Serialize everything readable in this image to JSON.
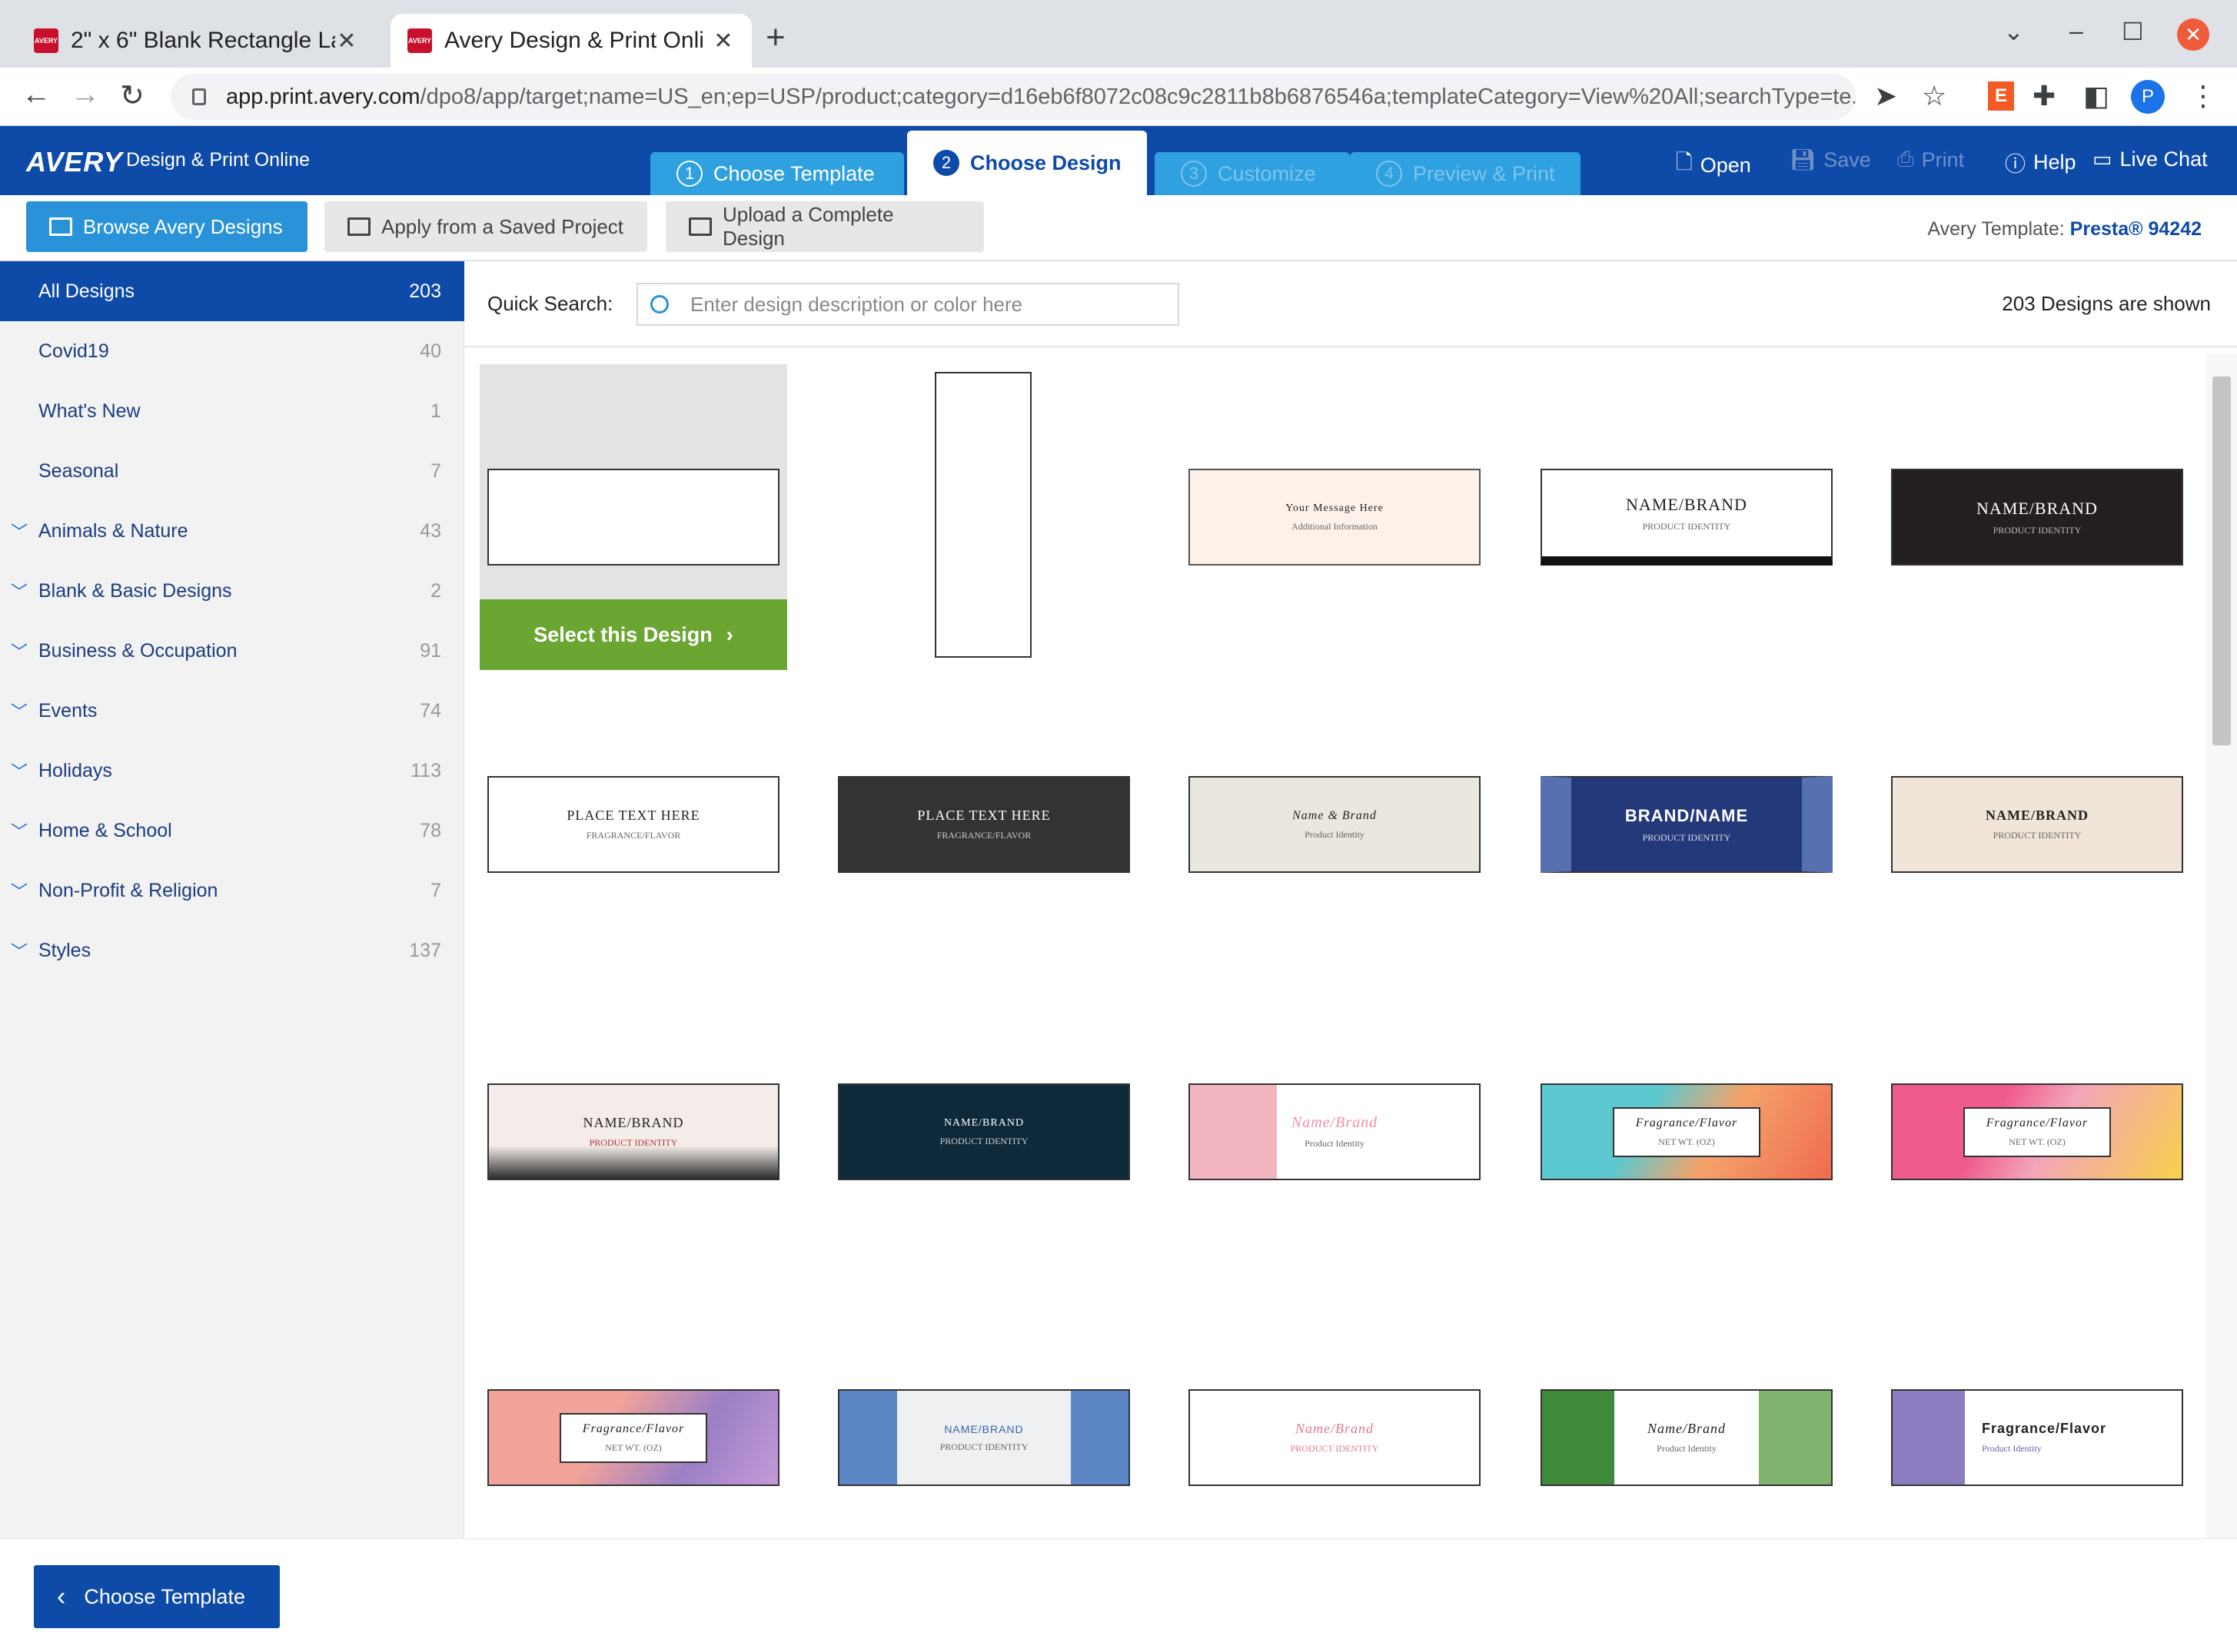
{
  "browser": {
    "tabs": [
      {
        "title": "2\" x 6\" Blank Rectangle La",
        "favicon": "AVERY"
      },
      {
        "title": "Avery Design & Print Onli",
        "favicon": "AVERY"
      }
    ],
    "url_host": "app.print.avery.com",
    "url_path": "/dpo8/app/target;name=US_en;ep=USP/product;category=d16eb6f8072c08c9c2811b8b6876546a;templateCategory=View%20All;searchType=te...",
    "profile_initial": "P",
    "ext_letter": "E"
  },
  "app": {
    "logo": "AVERY",
    "name": "Design & Print Online",
    "steps": [
      {
        "num": "1",
        "label": "Choose Template"
      },
      {
        "num": "2",
        "label": "Choose Design"
      },
      {
        "num": "3",
        "label": "Customize"
      },
      {
        "num": "4",
        "label": "Preview & Print"
      }
    ],
    "actions": {
      "open": "Open",
      "save": "Save",
      "print": "Print",
      "help": "Help",
      "chat": "Live Chat"
    }
  },
  "subbar": {
    "browse": "Browse Avery Designs",
    "apply": "Apply from a Saved Project",
    "upload": "Upload a Complete Design",
    "template_label": "Avery Template:",
    "template_value": "Presta® 94242"
  },
  "sidebar": {
    "items": [
      {
        "label": "All Designs",
        "count": "203"
      },
      {
        "label": "Covid19",
        "count": "40"
      },
      {
        "label": "What's New",
        "count": "1"
      },
      {
        "label": "Seasonal",
        "count": "7"
      },
      {
        "label": "Animals & Nature",
        "count": "43"
      },
      {
        "label": "Blank & Basic Designs",
        "count": "2"
      },
      {
        "label": "Business & Occupation",
        "count": "91"
      },
      {
        "label": "Events",
        "count": "74"
      },
      {
        "label": "Holidays",
        "count": "113"
      },
      {
        "label": "Home & School",
        "count": "78"
      },
      {
        "label": "Non-Profit & Religion",
        "count": "7"
      },
      {
        "label": "Styles",
        "count": "137"
      }
    ]
  },
  "main": {
    "quick_search_label": "Quick Search:",
    "search_placeholder": "Enter design description or color here",
    "shown_text": "203 Designs are shown",
    "select_button": "Select this Design",
    "designs": [
      {
        "t1": "Your Message Here",
        "t2": "Additional Information"
      },
      {
        "t1": "NAME/BRAND",
        "t2": "PRODUCT IDENTITY"
      },
      {
        "t1": "NAME/BRAND",
        "t2": "PRODUCT IDENTITY"
      },
      {
        "t1": "PLACE TEXT HERE",
        "t2": "FRAGRANCE/FLAVOR"
      },
      {
        "t1": "PLACE TEXT HERE",
        "t2": "FRAGRANCE/FLAVOR"
      },
      {
        "t1": "Name & Brand",
        "t2": "Product Identity"
      },
      {
        "t1": "BRAND/NAME",
        "t2": "PRODUCT IDENTITY"
      },
      {
        "t1": "NAME/BRAND",
        "t2": "PRODUCT IDENTITY"
      },
      {
        "t1": "NAME/BRAND",
        "t2": "PRODUCT IDENTITY"
      },
      {
        "t1": "NAME/BRAND",
        "t2": "PRODUCT IDENTITY"
      },
      {
        "t1": "Name/Brand",
        "t2": "Product Identity"
      },
      {
        "t1": "Fragrance/Flavor",
        "t2": "NET WT. (OZ)"
      },
      {
        "t1": "Fragrance/Flavor",
        "t2": "NET WT. (OZ)"
      },
      {
        "t1": "Fragrance/Flavor",
        "t2": "NET WT. (OZ)"
      },
      {
        "t1": "NAME/BRAND",
        "t2": "PRODUCT IDENTITY"
      },
      {
        "t1": "Name/Brand",
        "t2": "PRODUCT IDENTITY"
      },
      {
        "t1": "Name/Brand",
        "t2": "Product Identity"
      },
      {
        "t1": "Fragrance/Flavor",
        "t2": "Product Identity"
      }
    ]
  },
  "footer": {
    "back": "Choose Template"
  },
  "colors": {
    "brand": "#0e4aa7",
    "accent": "#2a92d8",
    "select": "#6aa631"
  }
}
